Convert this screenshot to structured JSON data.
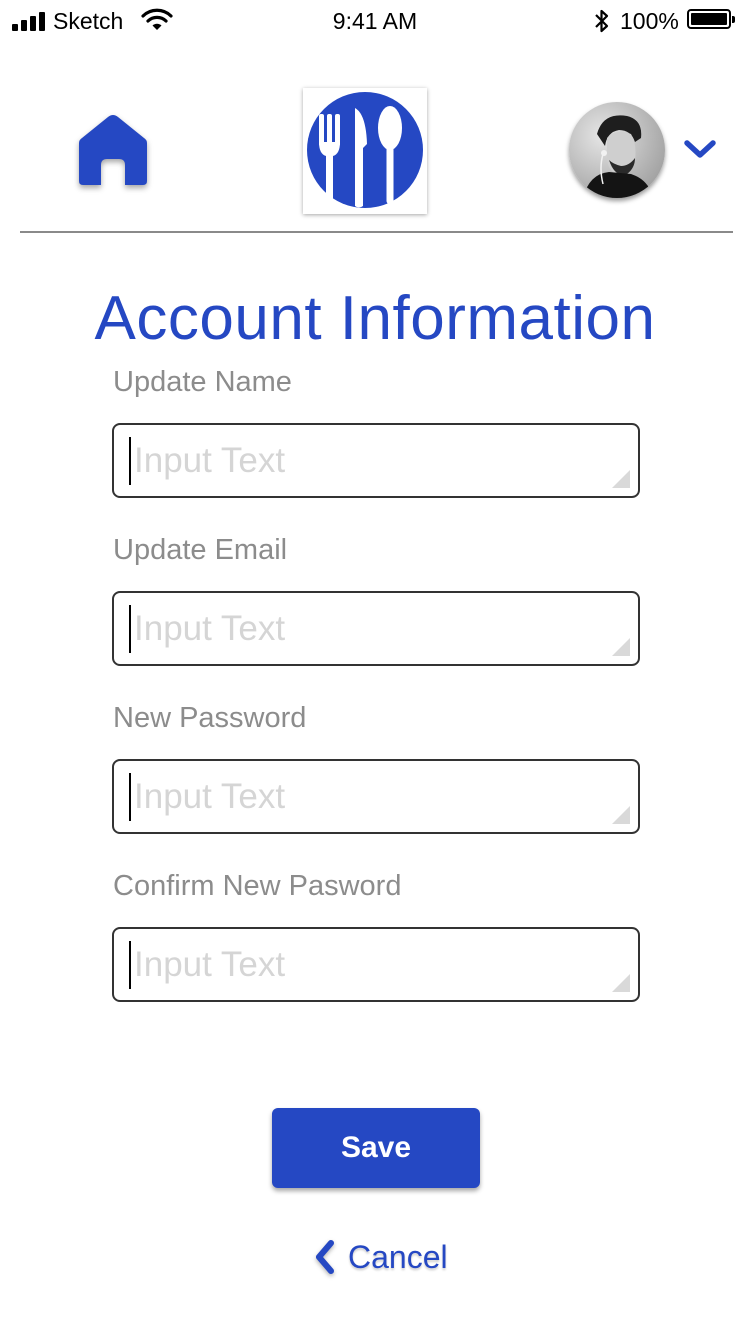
{
  "status_bar": {
    "carrier": "Sketch",
    "time": "9:41 AM",
    "battery_percent": "100%",
    "battery_level": 1.0,
    "icons": [
      "signal-icon",
      "wifi-icon",
      "bluetooth-icon",
      "battery-icon"
    ]
  },
  "header": {
    "home_icon": "home-icon",
    "logo_icon": "fork-knife-spoon-icon",
    "avatar": "user-avatar",
    "menu_icon": "chevron-down-icon"
  },
  "page": {
    "title": "Account Information"
  },
  "form": {
    "fields": [
      {
        "label": "Update Name",
        "placeholder": "Input Text",
        "value": ""
      },
      {
        "label": "Update Email",
        "placeholder": "Input Text",
        "value": ""
      },
      {
        "label": "New Password",
        "placeholder": "Input Text",
        "value": ""
      },
      {
        "label": "Confirm New Pasword",
        "placeholder": "Input Text",
        "value": ""
      }
    ]
  },
  "actions": {
    "save_label": "Save",
    "cancel_label": "Cancel",
    "cancel_icon": "chevron-left-icon"
  },
  "colors": {
    "accent": "#2548c3",
    "label": "#8c8c8c",
    "placeholder": "#d5d5d5",
    "border": "#333333"
  }
}
